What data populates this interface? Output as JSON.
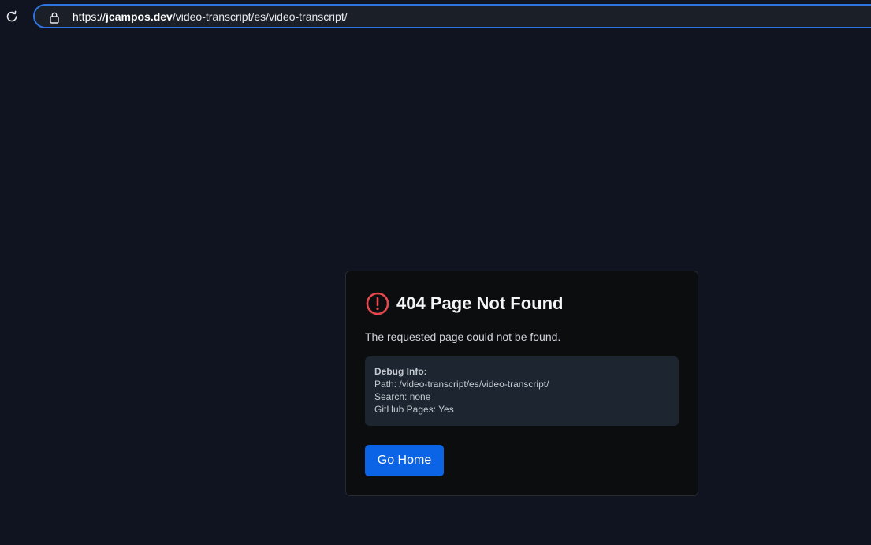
{
  "browser": {
    "url_scheme": "https://",
    "url_host": "jcampos.dev",
    "url_path": "/video-transcript/es/video-transcript/",
    "reload_icon": "reload-icon",
    "lock_icon": "lock-icon"
  },
  "error": {
    "icon": "alert-circle-icon",
    "title": "404 Page Not Found",
    "message": "The requested page could not be found.",
    "debug": {
      "heading": "Debug Info:",
      "path": "Path: /video-transcript/es/video-transcript/",
      "search": "Search: none",
      "github_pages": "GitHub Pages: Yes"
    },
    "home_button": "Go Home"
  },
  "colors": {
    "background": "#0f1420",
    "card": "#0c0d0f",
    "debug_panel": "#1c2530",
    "accent": "#0b63e5",
    "alert": "#e5484d",
    "urlbar_border": "#2f73e0"
  }
}
